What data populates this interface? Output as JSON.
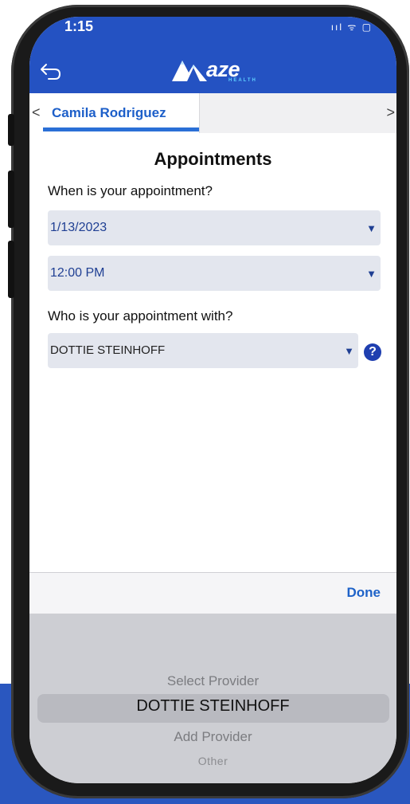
{
  "status_bar": {
    "time": "1:15",
    "icons_text": "ııl ᯤ ▢"
  },
  "header": {
    "back_icon": "back-arrow-icon",
    "logo_text": "aze",
    "logo_subtext": "HEALTH",
    "brand_color": "#2452c2"
  },
  "tabs": {
    "prev_glyph": "<",
    "active_label": "Camila Rodriguez",
    "next_glyph": ">"
  },
  "page": {
    "title": "Appointments",
    "when_label": "When is your appointment?",
    "date_value": "1/13/2023",
    "time_value": "12:00 PM",
    "who_label": "Who is your appointment with?",
    "provider_value": "DOTTIE STEINHOFF",
    "dropdown_arrow": "▼",
    "help_glyph": "?"
  },
  "picker": {
    "done_label": "Done",
    "options": [
      "Select Provider",
      "DOTTIE STEINHOFF",
      "Add Provider",
      "Other"
    ],
    "selected": "DOTTIE STEINHOFF"
  }
}
